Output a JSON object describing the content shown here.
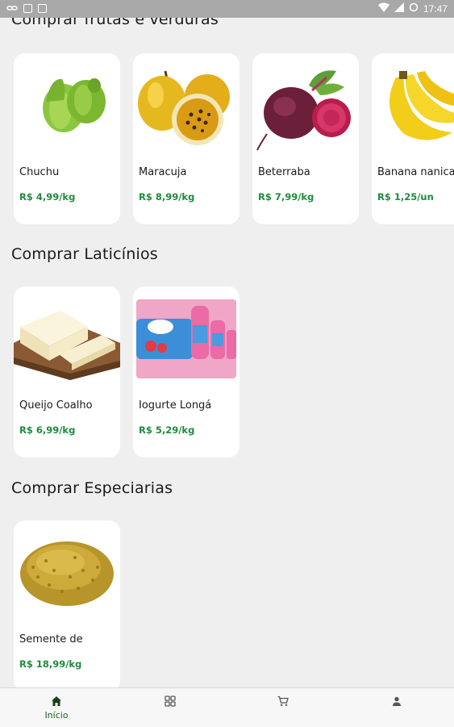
{
  "status_bar": {
    "time": "17:47",
    "icons": [
      "link-icon",
      "notification-icon",
      "image-icon",
      "wifi-icon",
      "signal-icon",
      "battery-icon"
    ]
  },
  "colors": {
    "price": "#1e8c3c",
    "active_nav": "#1b5e20",
    "background": "#efefef"
  },
  "sections": [
    {
      "title": "Comprar frutas e verduras",
      "products": [
        {
          "name": "Chuchu",
          "price": "R$ 4,99/kg",
          "image": "chayote"
        },
        {
          "name": "Maracuja",
          "price": "R$ 8,99/kg",
          "image": "passion-fruit"
        },
        {
          "name": "Beterraba",
          "price": "R$ 7,99/kg",
          "image": "beetroot"
        },
        {
          "name": "Banana nanica",
          "price": "R$ 1,25/un",
          "image": "banana"
        }
      ]
    },
    {
      "title": "Comprar Laticínios",
      "products": [
        {
          "name": "Queijo Coalho",
          "price": "R$ 6,99/kg",
          "image": "cheese"
        },
        {
          "name": "Iogurte Longá",
          "price": "R$ 5,29/kg",
          "image": "yogurt"
        }
      ]
    },
    {
      "title": "Comprar Especiarias",
      "products": [
        {
          "name": "Semente de",
          "price": "R$ 18,99/kg",
          "image": "seeds"
        }
      ]
    }
  ],
  "bottom_nav": [
    {
      "label": "Início",
      "icon": "home-icon",
      "active": true
    },
    {
      "label": "",
      "icon": "categories-icon",
      "active": false
    },
    {
      "label": "",
      "icon": "cart-icon",
      "active": false
    },
    {
      "label": "",
      "icon": "profile-icon",
      "active": false
    }
  ]
}
